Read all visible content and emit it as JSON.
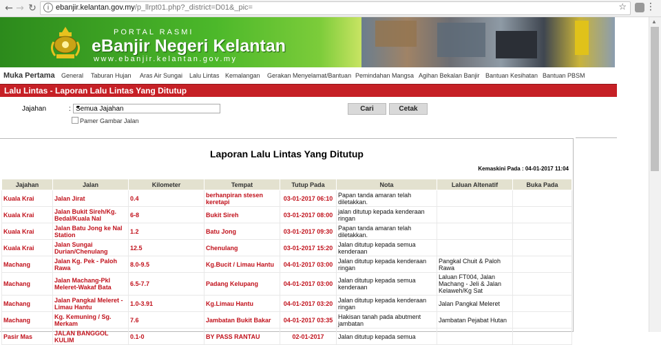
{
  "browser": {
    "url_host": "ebanjir.kelantan.gov.my",
    "url_path": "/p_llrpt01.php?_district=D01&_pic="
  },
  "banner": {
    "portal": "PORTAL RASMI",
    "brand": "eBanjir Negeri Kelantan",
    "site": "www.ebanjir.kelantan.gov.my"
  },
  "menu": [
    {
      "label": "Muka Pertama"
    },
    {
      "label": "General"
    },
    {
      "label": "Taburan Hujan"
    },
    {
      "label": "Aras Air Sungai"
    },
    {
      "label": "Lalu Lintas"
    },
    {
      "label": "Kemalangan"
    },
    {
      "label": "Gerakan Menyelamat/Bantuan"
    },
    {
      "label": "Pemindahan Mangsa"
    },
    {
      "label": "Agihan Bekalan Banjir"
    },
    {
      "label": "Bantuan Kesihatan"
    },
    {
      "label": "Bantuan PBSM"
    }
  ],
  "page_title": "Lalu Lintas - Laporan Lalu Lintas Yang Ditutup",
  "form": {
    "jajahan_label": "Jajahan",
    "colon": ":",
    "jajahan_value": "Semua Jajahan",
    "pamer_label": "Pamer Gambar Jalan",
    "cari_label": "Cari",
    "cetak_label": "Cetak"
  },
  "report": {
    "title": "Laporan Lalu Lintas Yang Ditutup",
    "updated": "Kemaskini Pada : 04-01-2017 11:04",
    "headers": [
      "Jajahan",
      "Jalan",
      "Kilometer",
      "Tempat",
      "Tutup Pada",
      "Nota",
      "Laluan Altenatif",
      "Buka Pada"
    ],
    "rows": [
      {
        "jajahan": "Kuala Krai",
        "jalan": "Jalan Jirat",
        "km": "0.4",
        "tempat": "berhanpiran stesen keretapi",
        "tutup": "03-01-2017 06:10",
        "nota": "Papan tanda amaran telah diletakkan.",
        "laluan": "",
        "buka": ""
      },
      {
        "jajahan": "Kuala Krai",
        "jalan": "Jalan Bukit Sireh/Kg. Bedal/Kuala Nal",
        "km": "6-8",
        "tempat": "Bukit Sireh",
        "tutup": "03-01-2017 08:00",
        "nota": "jalan ditutup kepada kenderaan ringan",
        "laluan": "",
        "buka": ""
      },
      {
        "jajahan": "Kuala Krai",
        "jalan": "Jalan Batu Jong ke Nal Station",
        "km": "1.2",
        "tempat": "Batu Jong",
        "tutup": "03-01-2017 09:30",
        "nota": "Papan tanda amaran telah diletakkan.",
        "laluan": "",
        "buka": ""
      },
      {
        "jajahan": "Kuala Krai",
        "jalan": "Jalan Sungai Durian/Chenulang",
        "km": "12.5",
        "tempat": "Chenulang",
        "tutup": "03-01-2017 15:20",
        "nota": "Jalan ditutup kepada semua kenderaan",
        "laluan": "",
        "buka": ""
      },
      {
        "jajahan": "Machang",
        "jalan": "Jalan Kg. Pek - Paloh Rawa",
        "km": "8.0-9.5",
        "tempat": "Kg.Bucit / Limau Hantu",
        "tutup": "04-01-2017 03:00",
        "nota": "Jalan ditutup kepada kenderaan ringan",
        "laluan": "Pangkal Chuit & Paloh Rawa",
        "buka": ""
      },
      {
        "jajahan": "Machang",
        "jalan": "Jalan Machang-Pkl Meleret-Wakaf Bata",
        "km": "6.5-7.7",
        "tempat": "Padang Kelupang",
        "tutup": "04-01-2017 03:00",
        "nota": "Jalan ditutup kepada semua kenderaan",
        "laluan": "Laluan FT004, Jalan Machang - Jeli & Jalan Kelaweh/Kg Sat",
        "buka": ""
      },
      {
        "jajahan": "Machang",
        "jalan": "Jalan Pangkal Meleret - Limau Hantu",
        "km": "1.0-3.91",
        "tempat": "Kg.Limau Hantu",
        "tutup": "04-01-2017 03:20",
        "nota": "Jalan ditutup kepada kenderaan ringan",
        "laluan": "Jalan Pangkal Meleret",
        "buka": ""
      },
      {
        "jajahan": "Machang",
        "jalan": "Kg. Kemuning / Sg. Merkam",
        "km": "7.6",
        "tempat": "Jambatan Bukit Bakar",
        "tutup": "04-01-2017 03:35",
        "nota": "Hakisan tanah pada abutment jambatan",
        "laluan": "Jambatan Pejabat Hutan",
        "buka": ""
      },
      {
        "jajahan": "Pasir Mas",
        "jalan": "JALAN BANGGOL KULIM",
        "km": "0.1-0",
        "tempat": "BY PASS RANTAU",
        "tutup": "02-01-2017",
        "nota": "Jalan ditutup kepada semua",
        "laluan": "",
        "buka": ""
      }
    ]
  }
}
